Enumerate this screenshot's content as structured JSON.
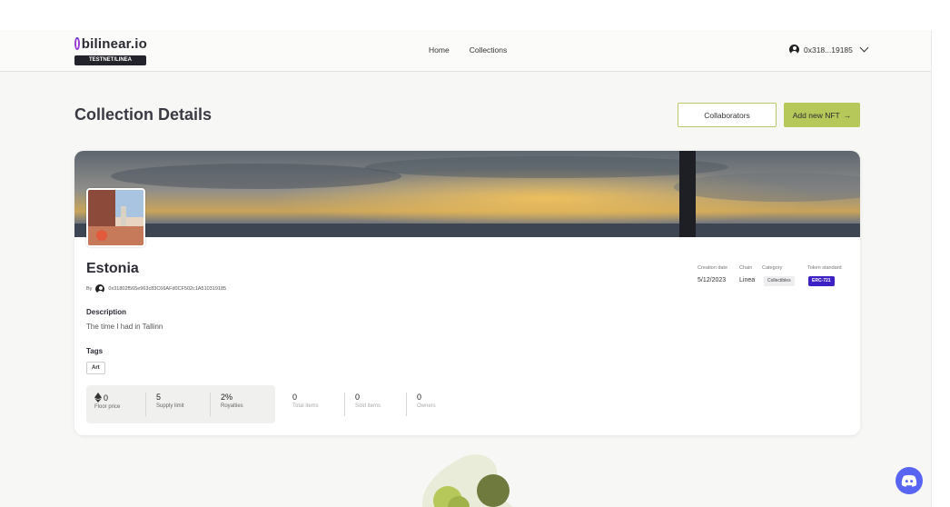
{
  "header": {
    "logo_text": "bilinear.io",
    "network_badge": "TESTNET/LINEA",
    "nav": [
      "Home",
      "Collections"
    ],
    "wallet_address": "0x318...19185"
  },
  "page": {
    "title": "Collection Details",
    "collaborators_button": "Collaborators",
    "add_nft_button": "Add new NFT",
    "add_nft_arrow": "→"
  },
  "collection": {
    "name": "Estonia",
    "by_label": "By",
    "creator_address": "0x31802f565e963c83C66AFd0CF502c1A510319185",
    "description_label": "Description",
    "description": "The time I had in Tallinn",
    "tags_label": "Tags",
    "tags": [
      "Art"
    ],
    "meta": {
      "creation_date_label": "Creation date",
      "creation_date": "5/12/2023",
      "chain_label": "Chain",
      "chain": "Linea",
      "category_label": "Category",
      "category": "Collectibles",
      "token_standard_label": "Token standard",
      "token_standard": "ERC-721"
    },
    "stats": {
      "floor_price": "0",
      "floor_price_label": "Floor price",
      "supply_limit": "5",
      "supply_limit_label": "Supply limit",
      "royalties": "2%",
      "royalties_label": "Royalties",
      "total_items": "0",
      "total_items_label": "Total items",
      "sold_items": "0",
      "sold_items_label": "Sold items",
      "owners": "0",
      "owners_label": "Owners"
    }
  },
  "colors": {
    "accent_green": "#b6c85a",
    "erc_badge": "#3d21c4",
    "discord": "#5865f2"
  },
  "icons": [
    "account-icon",
    "chevron-down-icon",
    "ethereum-icon",
    "arrow-right-icon",
    "discord-icon"
  ]
}
